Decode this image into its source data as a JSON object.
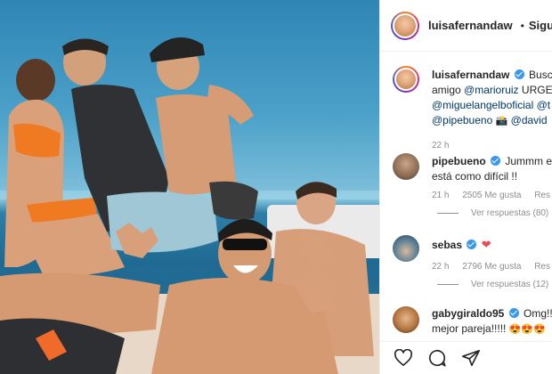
{
  "post": {
    "author": "luisafernandaw",
    "header_separator": "•",
    "follow_label": "Sigu"
  },
  "comments": [
    {
      "user": "luisafernandaw",
      "verified": true,
      "line1_text": "Busco",
      "line2_prefix": "amigo ",
      "line2_mention": "@marioruiz",
      "line2_suffix": " URGE",
      "line3_mention": "@miguelangelboficial",
      "line3_suffix": " @t",
      "line4_mention1": "@pipebueno",
      "line4_emoji": "📸",
      "line4_mention2": "@david",
      "time": "22 h"
    },
    {
      "user": "pipebueno",
      "verified": true,
      "line1_text": "Jummm es",
      "line2_text": "está como difícil !!",
      "time": "21 h",
      "likes": "2505 Me gusta",
      "reply": "Res",
      "view_replies": "Ver respuestas (80)"
    },
    {
      "user": "sebas",
      "verified": true,
      "line1_emoji": "❤",
      "time": "22 h",
      "likes": "2796 Me gusta",
      "reply": "Res",
      "view_replies": "Ver respuestas (12)"
    },
    {
      "user": "gabygiraldo95",
      "verified": true,
      "line1_text": "Omg!!!",
      "line2_text": "mejor pareja!!!!! ",
      "line2_emojis": "😍😍😍"
    }
  ],
  "actions": {
    "like_icon": "heart-outline-icon",
    "comment_icon": "comment-bubble-icon",
    "share_icon": "paper-plane-icon"
  }
}
